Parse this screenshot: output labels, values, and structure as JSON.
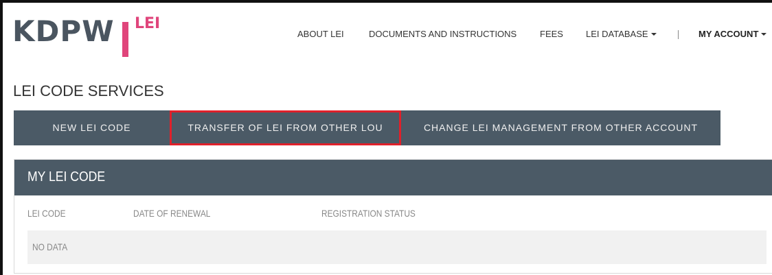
{
  "logo": {
    "brand": "KDPW",
    "suffix": "LEI"
  },
  "nav": {
    "items": [
      {
        "label": "ABOUT LEI"
      },
      {
        "label": "DOCUMENTS AND INSTRUCTIONS"
      },
      {
        "label": "FEES"
      },
      {
        "label": "LEI DATABASE"
      },
      {
        "label": "MY ACCOUNT"
      }
    ]
  },
  "page": {
    "title": "LEI CODE SERVICES"
  },
  "tabs": [
    {
      "label": "NEW LEI CODE"
    },
    {
      "label": "TRANSFER OF LEI FROM OTHER LOU",
      "highlighted": true
    },
    {
      "label": "CHANGE LEI MANAGEMENT FROM OTHER ACCOUNT"
    }
  ],
  "panel": {
    "title": "MY LEI CODE",
    "columns": [
      "LEI CODE",
      "DATE OF RENEWAL",
      "REGISTRATION STATUS"
    ],
    "empty_text": "NO DATA"
  },
  "colors": {
    "brand_pink": "#e0457b",
    "header_slate": "#4b5a66",
    "highlight_red": "#e0202a"
  }
}
